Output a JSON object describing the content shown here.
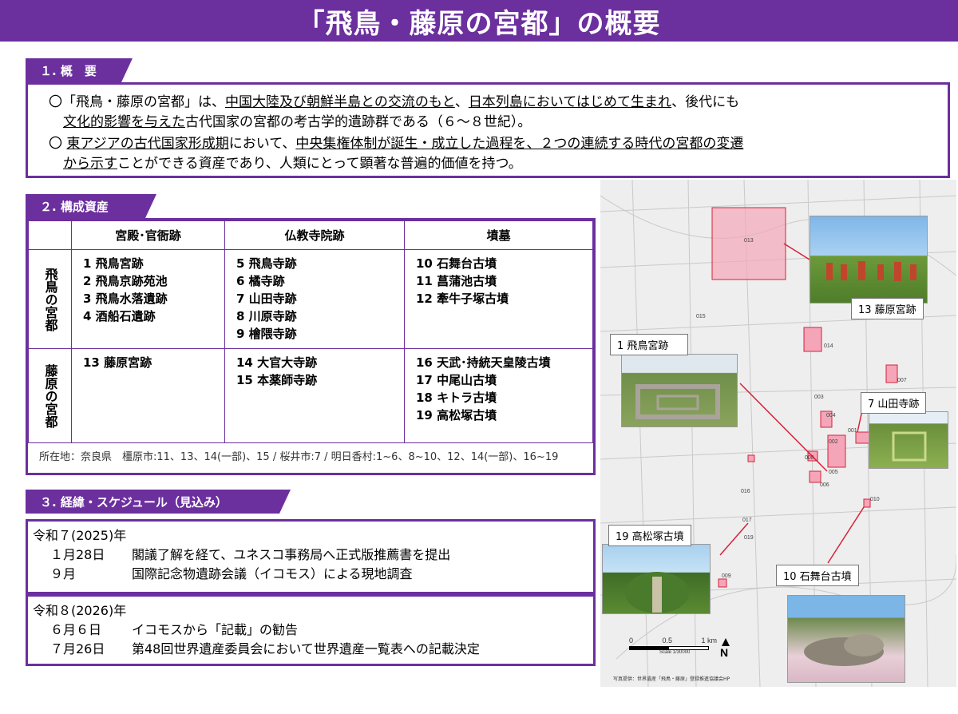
{
  "title": "「飛鳥・藤原の宮都」の概要",
  "sections": {
    "overview": {
      "label": "１. 概　要",
      "bullet1_pre": "〇「飛鳥・藤原の宮都」は、",
      "bullet1_u1": "中国大陸及び朝鮮半島との交流のもと",
      "bullet1_mid": "、",
      "bullet1_u2": "日本列島においてはじめて生まれ",
      "bullet1_post": "、後代にも",
      "bullet1_line2_u": "文化的影響を与えた",
      "bullet1_line2_post": "古代国家の宮都の考古学的遺跡群である（６～８世紀）。",
      "bullet2_pre": "〇 ",
      "bullet2_u1": "東アジアの古代国家形成期",
      "bullet2_mid": "において、",
      "bullet2_u2": "中央集権体制が誕生・成立した過程を、２つの連続する時代の宮都の変遷",
      "bullet2_line2_u": "から示す",
      "bullet2_line2_post": "ことができる資産であり、人類にとって顕著な普遍的価値を持つ。"
    },
    "assets": {
      "label": "２. 構成資産",
      "headers": [
        "宮殿･官衙跡",
        "仏教寺院跡",
        "墳墓"
      ],
      "eras": [
        {
          "name": "飛鳥の宮都",
          "palace": [
            "1 飛鳥宮跡",
            "2 飛鳥京跡苑池",
            "3 飛鳥水落遺跡",
            "4 酒船石遺跡"
          ],
          "temple": [
            "5 飛鳥寺跡",
            "6 橘寺跡",
            "7 山田寺跡",
            "8 川原寺跡",
            "9 檜隈寺跡"
          ],
          "tomb": [
            "10 石舞台古墳",
            "11 菖蒲池古墳",
            "12 牽牛子塚古墳"
          ]
        },
        {
          "name": "藤原の宮都",
          "palace": [
            "13 藤原宮跡"
          ],
          "temple": [
            "14 大官大寺跡",
            "15 本薬師寺跡"
          ],
          "tomb": [
            "16 天武･持統天皇陵古墳",
            "17 中尾山古墳",
            "18 キトラ古墳",
            "19 高松塚古墳"
          ]
        }
      ],
      "location": "所在地：奈良県　橿原市:11、13、14(一部)、15 / 桜井市:7 / 明日香村:1~6、8~10、12、14(一部)、16~19"
    },
    "schedule": {
      "label": "３. 経緯・スケジュール（見込み）",
      "blocks": [
        {
          "year": "令和７(2025)年",
          "rows": [
            {
              "date": "１月28日",
              "text": "閣議了解を経て、ユネスコ事務局へ正式版推薦書を提出"
            },
            {
              "date": "９月",
              "text": "国際記念物遺跡会議（イコモス）による現地調査"
            }
          ]
        },
        {
          "year": "令和８(2026)年",
          "rows": [
            {
              "date": "６月６日",
              "text": "イコモスから「記載」の勧告"
            },
            {
              "date": "７月26日",
              "text": "第48回世界遺産委員会において世界遺産一覧表への記載決定"
            }
          ]
        }
      ]
    }
  },
  "map": {
    "callouts": [
      "13 藤原宮跡",
      "1 飛鳥宮跡",
      "7 山田寺跡",
      "19 高松塚古墳",
      "10 石舞台古墳"
    ],
    "labels": [
      "013",
      "015",
      "014",
      "007",
      "003",
      "004",
      "002",
      "001",
      "008",
      "005",
      "006",
      "016",
      "010",
      "017",
      "019",
      "009"
    ],
    "scale": {
      "ticks": [
        "0",
        "0.5",
        "1 km"
      ],
      "text": "Scale 1/30000"
    },
    "north": "N",
    "credit": "写真提供：世界遺産「飛鳥・藤原」登録推進協議会HP"
  },
  "colors": {
    "accent": "#6b2f9e",
    "site": "#f4a6b8",
    "line": "#d6223a"
  }
}
